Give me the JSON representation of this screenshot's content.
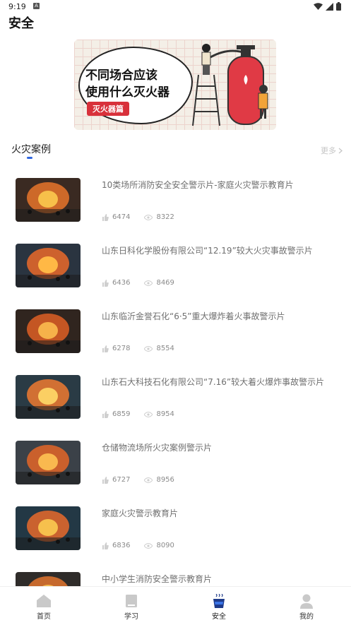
{
  "status_bar": {
    "time": "9:19",
    "notification_badge": "A"
  },
  "header": {
    "title": "安全"
  },
  "banner": {
    "line1": "不同场合应该",
    "line2": "使用什么灭火器",
    "tag": "灭火器篇"
  },
  "section": {
    "title": "火灾案例",
    "more": "更多"
  },
  "cases": [
    {
      "title": "10类场所消防安全安全警示片-家庭火灾警示教育片",
      "likes": "6474",
      "views": "8322"
    },
    {
      "title": "山东日科化学股份有限公司“12.19”较大火灾事故警示片",
      "likes": "6436",
      "views": "8469"
    },
    {
      "title": "山东临沂金誉石化“6·5”重大爆炸着火事故警示片",
      "likes": "6278",
      "views": "8554"
    },
    {
      "title": "山东石大科技石化有限公司“7.16”较大着火爆炸事故警示片",
      "likes": "6859",
      "views": "8954"
    },
    {
      "title": "仓储物流场所火灾案例警示片",
      "likes": "6727",
      "views": "8956"
    },
    {
      "title": "家庭火灾警示教育片",
      "likes": "6836",
      "views": "8090"
    },
    {
      "title": "中小学生消防安全警示教育片",
      "likes": "",
      "views": ""
    }
  ],
  "tabs": [
    {
      "label": "首页",
      "icon": "home-icon"
    },
    {
      "label": "学习",
      "icon": "book-icon"
    },
    {
      "label": "安全",
      "icon": "safety-cup-icon"
    },
    {
      "label": "我的",
      "icon": "user-icon"
    }
  ],
  "colors": {
    "accent": "#2f66e0",
    "banner_tag": "#d8313b",
    "extinguisher": "#e03a45"
  }
}
